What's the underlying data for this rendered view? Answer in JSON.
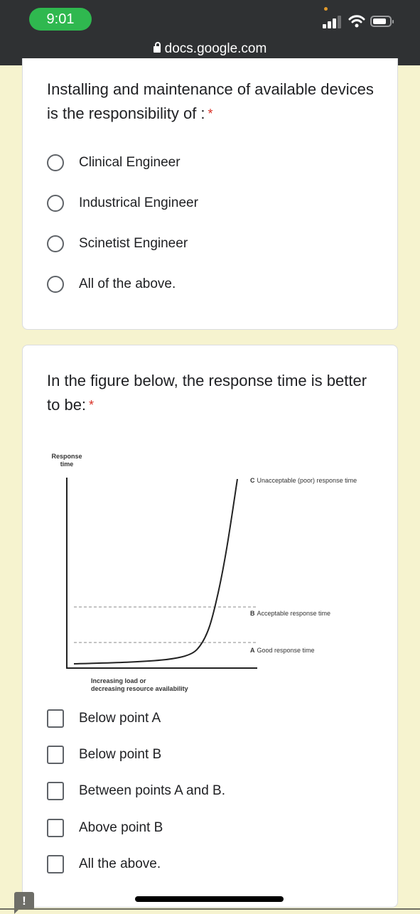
{
  "status_bar": {
    "time": "9:01",
    "url": "docs.google.com",
    "icons": [
      "lock-icon",
      "signal-icon",
      "wifi-icon",
      "battery-icon"
    ]
  },
  "questions": [
    {
      "text": "Installing and maintenance of available devices is the responsibility of :",
      "required_marker": "*",
      "type": "radio",
      "options": [
        {
          "label": "Clinical Engineer",
          "selected": false
        },
        {
          "label": "Industrical Engineer",
          "selected": false
        },
        {
          "label": "Scinetist Engineer",
          "selected": false
        },
        {
          "label": "All of the above.",
          "selected": false
        }
      ]
    },
    {
      "text": "In the figure below, the response time is better to be:",
      "required_marker": "*",
      "type": "checkbox",
      "figure": {
        "y_axis_label_line1": "Response",
        "y_axis_label_line2": "time",
        "x_axis_label_line1": "Increasing load or",
        "x_axis_label_line2": "decreasing resource availability",
        "level_c": {
          "letter": "C",
          "text": "Unacceptable (poor) response time"
        },
        "level_b": {
          "letter": "B",
          "text": "Acceptable response time"
        },
        "level_a": {
          "letter": "A",
          "text": "Good response time"
        }
      },
      "options": [
        {
          "label": "Below point A",
          "checked": false
        },
        {
          "label": "Below point B",
          "checked": false
        },
        {
          "label": "Between points A and B.",
          "checked": false
        },
        {
          "label": "Above point B",
          "checked": false
        },
        {
          "label": "All the above.",
          "checked": false
        }
      ]
    }
  ],
  "feedback_icon_glyph": "!",
  "colors": {
    "page_background": "#f6f3cf",
    "status_bar": "#2f3133",
    "time_pill": "#2fb84f",
    "required": "#d93025"
  }
}
